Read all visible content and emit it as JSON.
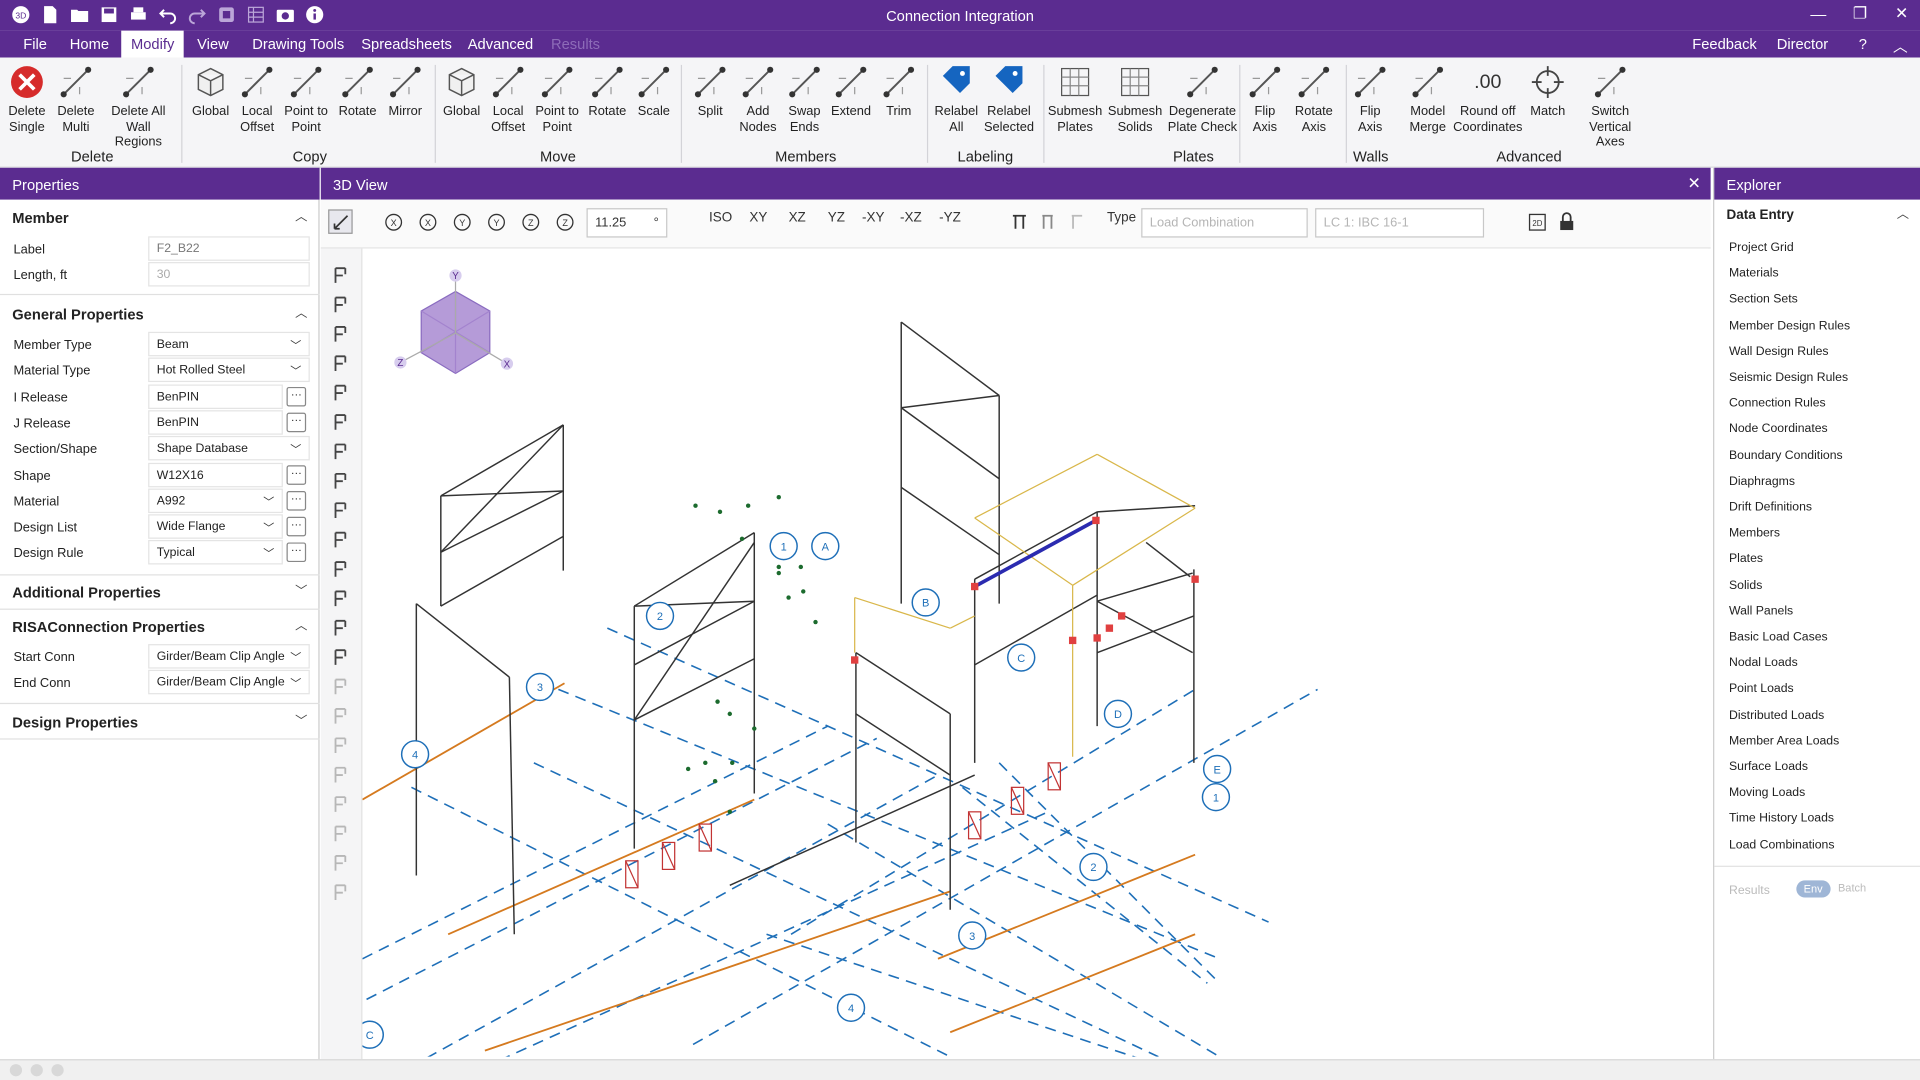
{
  "app": {
    "title": "Connection Integration",
    "accent": "#5b2c90"
  },
  "menu": [
    "File",
    "Home",
    "Modify",
    "View",
    "Drawing Tools",
    "Spreadsheets",
    "Advanced",
    "Results"
  ],
  "menu_right": {
    "feedback": "Feedback",
    "director": "Director",
    "help": "?"
  },
  "ribbon": {
    "buttons": [
      {
        "l1": "Delete",
        "l2": "Single",
        "icon": "delete-red-icon"
      },
      {
        "l1": "Delete",
        "l2": "Multi",
        "icon": "delete-list-icon"
      },
      {
        "l1": "Delete All",
        "l2": "Wall Regions",
        "icon": "delete-wall-icon"
      },
      {
        "l1": "Global",
        "l2": "",
        "icon": "cube-icon"
      },
      {
        "l1": "Local",
        "l2": "Offset",
        "icon": "local-offset-icon"
      },
      {
        "l1": "Point to",
        "l2": "Point",
        "icon": "point-to-point-icon"
      },
      {
        "l1": "Rotate",
        "l2": "",
        "icon": "rotate-icon"
      },
      {
        "l1": "Mirror",
        "l2": "",
        "icon": "mirror-icon"
      },
      {
        "l1": "Global",
        "l2": "",
        "icon": "cube-icon"
      },
      {
        "l1": "Local",
        "l2": "Offset",
        "icon": "local-offset-icon"
      },
      {
        "l1": "Point to",
        "l2": "Point",
        "icon": "point-to-point-icon"
      },
      {
        "l1": "Rotate",
        "l2": "",
        "icon": "rotate-icon"
      },
      {
        "l1": "Scale",
        "l2": "",
        "icon": "scale-icon"
      },
      {
        "l1": "Split",
        "l2": "",
        "icon": "split-icon"
      },
      {
        "l1": "Add",
        "l2": "Nodes",
        "icon": "add-nodes-icon"
      },
      {
        "l1": "Swap",
        "l2": "Ends",
        "icon": "swap-ends-icon"
      },
      {
        "l1": "Extend",
        "l2": "",
        "icon": "extend-icon"
      },
      {
        "l1": "Trim",
        "l2": "",
        "icon": "trim-icon"
      },
      {
        "l1": "Relabel",
        "l2": "All",
        "icon": "relabel-all-icon"
      },
      {
        "l1": "Relabel",
        "l2": "Selected",
        "icon": "relabel-selected-icon"
      },
      {
        "l1": "Submesh",
        "l2": "Plates",
        "icon": "submesh-plates-icon"
      },
      {
        "l1": "Submesh",
        "l2": "Solids",
        "icon": "submesh-solids-icon"
      },
      {
        "l1": "Degenerate",
        "l2": "Plate Check",
        "icon": "degenerate-plate-icon"
      },
      {
        "l1": "Flip",
        "l2": "Axis",
        "icon": "flip-axis-icon"
      },
      {
        "l1": "Rotate",
        "l2": "Axis",
        "icon": "rotate-axis-icon"
      },
      {
        "l1": "Flip",
        "l2": "Axis",
        "icon": "flip-axis-wall-icon"
      },
      {
        "l1": "Model",
        "l2": "Merge",
        "icon": "model-merge-icon"
      },
      {
        "l1": "Round off",
        "l2": "Coordinates",
        "icon": "round-off-icon"
      },
      {
        "l1": "Match",
        "l2": "",
        "icon": "match-icon"
      },
      {
        "l1": "Switch",
        "l2": "Vertical Axes",
        "icon": "switch-axes-icon"
      }
    ],
    "groups": [
      "Delete",
      "Copy",
      "Move",
      "Members",
      "Labeling",
      "Plates",
      "Walls",
      "Advanced"
    ]
  },
  "properties": {
    "header": "Properties",
    "member": {
      "title": "Member",
      "label_lbl": "Label",
      "label_val": "F2_B22",
      "length_lbl": "Length, ft",
      "length_val": "30"
    },
    "general": {
      "title": "General Properties",
      "rows": [
        {
          "label": "Member Type",
          "value": "Beam"
        },
        {
          "label": "Material Type",
          "value": "Hot Rolled Steel"
        },
        {
          "label": "I Release",
          "value": "BenPIN"
        },
        {
          "label": "J Release",
          "value": "BenPIN"
        },
        {
          "label": "Section/Shape",
          "value": "Shape Database"
        },
        {
          "label": "Shape",
          "value": "W12X16"
        },
        {
          "label": "Material",
          "value": "A992"
        },
        {
          "label": "Design List",
          "value": "Wide Flange"
        },
        {
          "label": "Design Rule",
          "value": "Typical"
        }
      ]
    },
    "additional": {
      "title": "Additional Properties"
    },
    "risa": {
      "title": "RISAConnection Properties",
      "rows": [
        {
          "label": "Start Conn",
          "value": "Girder/Beam Clip Angle"
        },
        {
          "label": "End Conn",
          "value": "Girder/Beam Clip Angle"
        }
      ]
    },
    "design": {
      "title": "Design Properties"
    }
  },
  "view": {
    "title": "3D View",
    "zoom": "11.25",
    "deg": "°",
    "views": [
      "ISO",
      "XY",
      "XZ",
      "YZ",
      "-XY",
      "-XZ",
      "-YZ"
    ],
    "type_label": "Type",
    "type_value": "Load Combination",
    "lc_value": "LC 1: IBC 16-1",
    "axes": {
      "y": "Y",
      "z": "Z",
      "x": "X"
    },
    "grid_labels": [
      "1",
      "A",
      "2",
      "B",
      "3",
      "C",
      "4",
      "D",
      "E",
      "1",
      "2",
      "3",
      "4",
      "C"
    ]
  },
  "explorer": {
    "header": "Explorer",
    "section": "Data Entry",
    "items": [
      "Project Grid",
      "Materials",
      "Section Sets",
      "Member Design Rules",
      "Wall Design Rules",
      "Seismic Design Rules",
      "Connection Rules",
      "Node Coordinates",
      "Boundary Conditions",
      "Diaphragms",
      "Drift Definitions",
      "Members",
      "Plates",
      "Solids",
      "Wall Panels",
      "Basic Load Cases",
      "Nodal Loads",
      "Point Loads",
      "Distributed Loads",
      "Member Area Loads",
      "Surface Loads",
      "Moving Loads",
      "Time History Loads",
      "Load Combinations"
    ],
    "results_label": "Results",
    "env": "Env",
    "batch": "Batch"
  }
}
